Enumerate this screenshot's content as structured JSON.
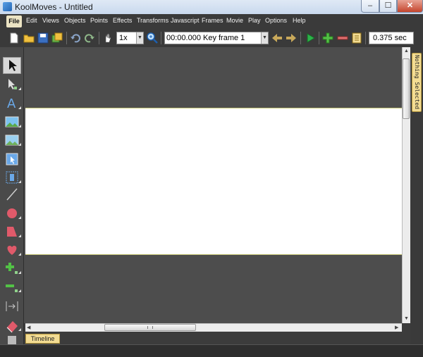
{
  "window": {
    "title": "KoolMoves - Untitled"
  },
  "menu": [
    "File",
    "Edit",
    "Views",
    "Objects",
    "Points",
    "Effects",
    "Transforms",
    "Javascript",
    "Frames",
    "Movie",
    "Play",
    "Options",
    "Help"
  ],
  "toolbar": {
    "zoom": "1x",
    "frame": "00:00.000  Key frame 1",
    "time": "0.375 sec"
  },
  "side_tab": {
    "label": "Nothing Selected"
  },
  "timeline_tab": {
    "label": "Timeline"
  },
  "colors": {
    "accent_tab": "#f3dc93",
    "canvas_bg": "#4d4d4d",
    "stage": "#ffffff"
  }
}
